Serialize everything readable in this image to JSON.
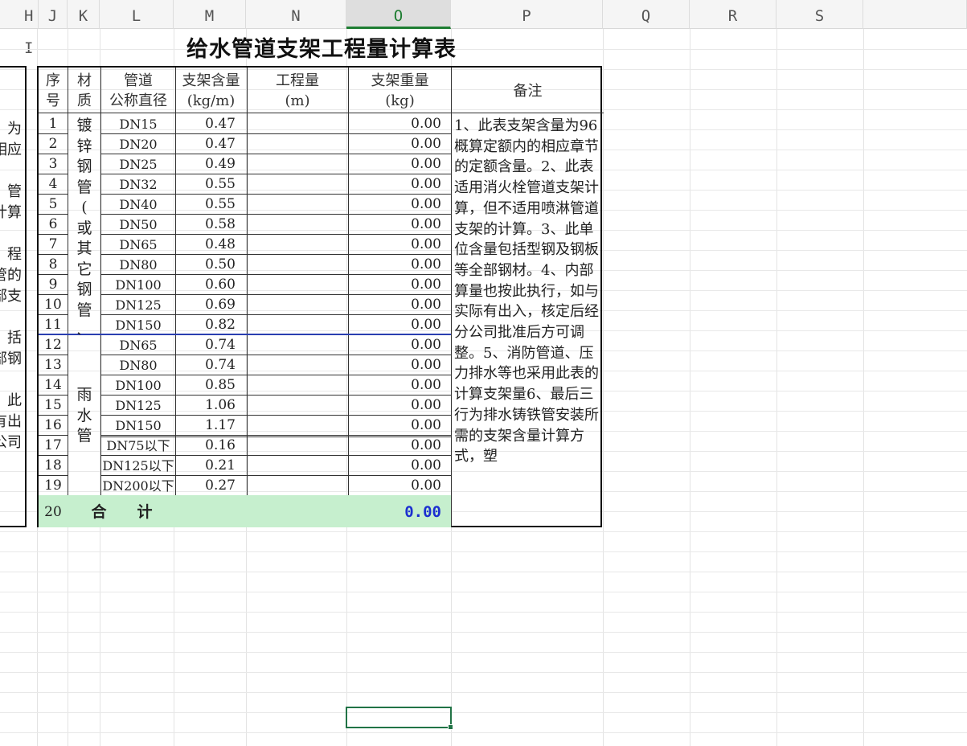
{
  "columns": [
    {
      "letter": "H"
    },
    {
      "letter": "I"
    },
    {
      "letter": "J"
    },
    {
      "letter": "K"
    },
    {
      "letter": "L"
    },
    {
      "letter": "M"
    },
    {
      "letter": "N"
    },
    {
      "letter": "O"
    },
    {
      "letter": "P"
    },
    {
      "letter": "Q"
    },
    {
      "letter": "R"
    },
    {
      "letter": "S"
    }
  ],
  "title": "给水管道支架工程量计算表",
  "headers": {
    "seq": [
      "序",
      "号"
    ],
    "material": [
      "材",
      "质"
    ],
    "diameter": [
      "管道",
      "公称直径"
    ],
    "support": [
      "支架含量",
      "(kg/m)"
    ],
    "quantity": [
      "工程量",
      "(m)"
    ],
    "weight": [
      "支架重量",
      "(kg)"
    ],
    "remark": "备注"
  },
  "rows": [
    {
      "seq": "1",
      "dn": "DN15",
      "support": "0.47",
      "weight": "0.00"
    },
    {
      "seq": "2",
      "dn": "DN20",
      "support": "0.47",
      "weight": "0.00"
    },
    {
      "seq": "3",
      "dn": "DN25",
      "support": "0.49",
      "weight": "0.00"
    },
    {
      "seq": "4",
      "dn": "DN32",
      "support": "0.55",
      "weight": "0.00"
    },
    {
      "seq": "5",
      "dn": "DN40",
      "support": "0.55",
      "weight": "0.00"
    },
    {
      "seq": "6",
      "dn": "DN50",
      "support": "0.58",
      "weight": "0.00"
    },
    {
      "seq": "7",
      "dn": "DN65",
      "support": "0.48",
      "weight": "0.00"
    },
    {
      "seq": "8",
      "dn": "DN80",
      "support": "0.50",
      "weight": "0.00"
    },
    {
      "seq": "9",
      "dn": "DN100",
      "support": "0.60",
      "weight": "0.00"
    },
    {
      "seq": "10",
      "dn": "DN125",
      "support": "0.69",
      "weight": "0.00"
    },
    {
      "seq": "11",
      "dn": "DN150",
      "support": "0.82",
      "weight": "0.00"
    },
    {
      "seq": "12",
      "dn": "DN65",
      "support": "0.74",
      "weight": "0.00"
    },
    {
      "seq": "13",
      "dn": "DN80",
      "support": "0.74",
      "weight": "0.00"
    },
    {
      "seq": "14",
      "dn": "DN100",
      "support": "0.85",
      "weight": "0.00"
    },
    {
      "seq": "15",
      "dn": "DN125",
      "support": "1.06",
      "weight": "0.00"
    },
    {
      "seq": "16",
      "dn": "DN150",
      "support": "1.17",
      "weight": "0.00"
    },
    {
      "seq": "17",
      "dn": "DN75以下",
      "support": "0.16",
      "weight": "0.00"
    },
    {
      "seq": "18",
      "dn": "DN125以下",
      "support": "0.21",
      "weight": "0.00"
    },
    {
      "seq": "19",
      "dn": "DN200以下",
      "support": "0.27",
      "weight": "0.00"
    }
  ],
  "material_groups": [
    {
      "chars": [
        "镀",
        "锌",
        "钢",
        "管",
        "(",
        "或",
        "其",
        "它",
        "钢",
        "管",
        "、"
      ]
    },
    {
      "chars": [
        "雨",
        "水",
        "管"
      ]
    }
  ],
  "total": {
    "seq": "20",
    "label": "合　　计",
    "value": "0.00"
  },
  "remarks": "1、此表支架含量为96概算定额内的相应章节的定额含量。2、此表适用消火栓管道支架计算，但不适用喷淋管道支架的计算。3、此单位含量包括型钢及钢板等全部钢材。4、内部算量也按此执行，如与实际有出入，核定后经分公司批准后方可调整。5、消防管道、压力排水等也采用此表的计算支架量6、最后三行为排水铸铁管安装所需的支架含量计算方式，塑",
  "left_fragment": [
    "为",
    "相应",
    "",
    "管",
    "计算",
    "",
    "程",
    "管的",
    "部支",
    "",
    "括",
    "部钢",
    "",
    "此",
    "有出",
    "公司"
  ]
}
